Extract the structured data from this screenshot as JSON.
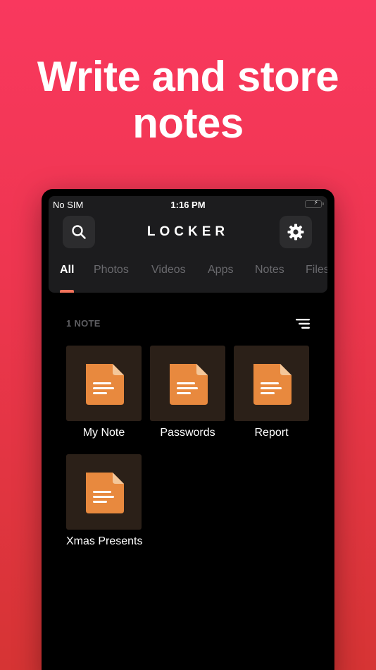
{
  "promo": {
    "headline_line1": "Write and store",
    "headline_line2": "notes"
  },
  "status_bar": {
    "carrier": "No SIM",
    "time": "1:16 PM",
    "battery_level": 1.0,
    "battery_color": "#3cd254"
  },
  "header": {
    "title": "LOCKER",
    "search_icon": "search-icon",
    "settings_icon": "gear-icon"
  },
  "tabs": [
    {
      "label": "All",
      "active": true
    },
    {
      "label": "Photos",
      "active": false
    },
    {
      "label": "Videos",
      "active": false
    },
    {
      "label": "Apps",
      "active": false
    },
    {
      "label": "Notes",
      "active": false
    },
    {
      "label": "Files",
      "active": false
    }
  ],
  "content": {
    "count_label": "1 NOTE",
    "sort_icon": "sort-icon",
    "items": [
      {
        "label": "My Note",
        "icon": "document-icon"
      },
      {
        "label": "Passwords",
        "icon": "document-icon"
      },
      {
        "label": "Report",
        "icon": "document-icon"
      },
      {
        "label": "Xmas Presents",
        "icon": "document-icon"
      }
    ]
  },
  "colors": {
    "background_gradient": [
      "#f9385e",
      "#d63434"
    ],
    "accent": "#f2735c",
    "document_icon": "#e8893e",
    "tile_background": "#2b2018"
  }
}
